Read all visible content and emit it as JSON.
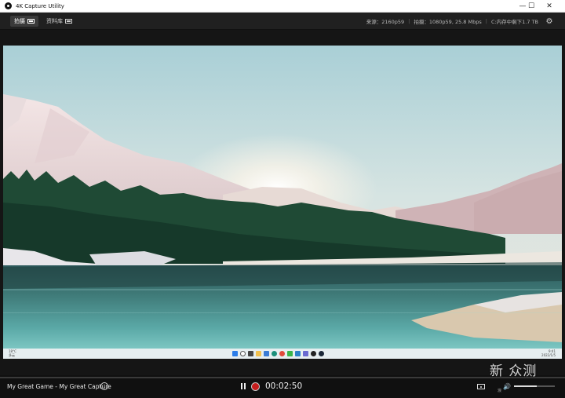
{
  "window": {
    "title": "4K Capture Utility",
    "controls": {
      "minimize": "—",
      "maximize": "☐",
      "close": "✕"
    }
  },
  "toolbar": {
    "tabs": [
      {
        "label": "拍摄",
        "icon": "capture-icon",
        "active": true
      },
      {
        "label": "资料库",
        "icon": "library-icon",
        "active": false
      }
    ],
    "status": {
      "source": "来源：2160p59",
      "capture": "拍摄：1080p59, 25.8 Mbps",
      "storage": "C:内存中剩下1.7 TB"
    },
    "settings_icon": "gear-icon"
  },
  "captured_taskbar": {
    "weather_temp": "18°C",
    "weather_desc": "多云",
    "clock_time": "9:41",
    "clock_date": "2022/1/5",
    "app_icons": [
      "windows-start-icon",
      "search-icon",
      "task-view-icon",
      "file-explorer-icon",
      "store-icon",
      "edge-icon",
      "chrome-icon",
      "wechat-icon",
      "mail-icon",
      "photos-icon",
      "obs-icon",
      "steam-icon"
    ]
  },
  "controls": {
    "capture_name": "My Great Game - My Great Capture",
    "timer": "00:02:50",
    "volume_level": 0.55
  },
  "watermark": {
    "main": "新 众测",
    "sub": "浪"
  },
  "colors": {
    "record": "#c51d1d",
    "accent": "#ffffff"
  }
}
